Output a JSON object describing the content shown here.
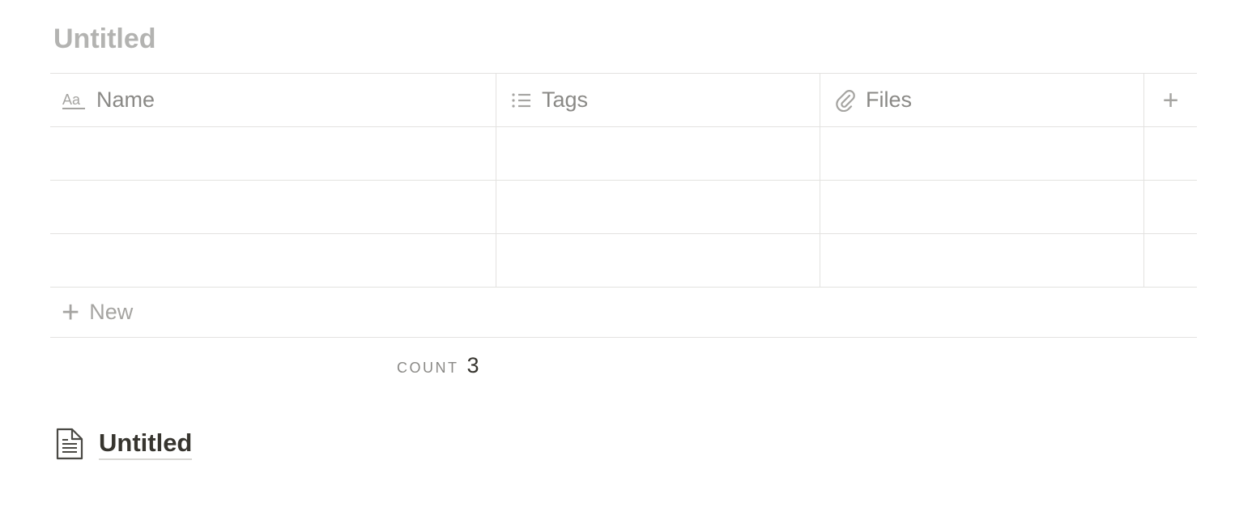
{
  "database": {
    "title": "Untitled",
    "columns": [
      {
        "label": "Name",
        "icon": "text-property-icon"
      },
      {
        "label": "Tags",
        "icon": "list-property-icon"
      },
      {
        "label": "Files",
        "icon": "paperclip-icon"
      }
    ],
    "add_column_icon": "plus-icon",
    "rows": [
      {
        "name": "",
        "tags": "",
        "files": ""
      },
      {
        "name": "",
        "tags": "",
        "files": ""
      },
      {
        "name": "",
        "tags": "",
        "files": ""
      }
    ],
    "new_row_label": "New",
    "footer": {
      "count_label": "COUNT",
      "count_value": "3"
    }
  },
  "linked_page": {
    "title": "Untitled",
    "icon": "document-icon"
  },
  "colors": {
    "text": "#37352f",
    "muted_text": "#8a8986",
    "placeholder_title": "#b3b3b1",
    "divider": "#e3e2e0"
  }
}
